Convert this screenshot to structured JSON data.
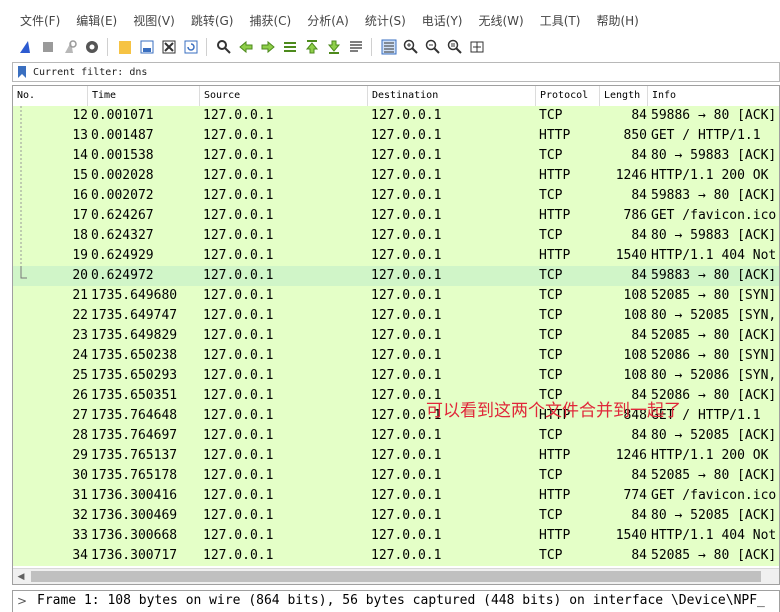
{
  "menu": [
    "文件(F)",
    "编辑(E)",
    "视图(V)",
    "跳转(G)",
    "捕获(C)",
    "分析(A)",
    "统计(S)",
    "电话(Y)",
    "无线(W)",
    "工具(T)",
    "帮助(H)"
  ],
  "toolbar_icons": [
    "shark-fin-start-icon",
    "stop-icon",
    "restart-icon",
    "capture-options-icon",
    "|",
    "open-file-icon",
    "save-file-icon",
    "close-file-icon",
    "reload-icon",
    "|",
    "find-packet-icon",
    "go-back-icon",
    "go-forward-icon",
    "go-to-packet-icon",
    "go-first-icon",
    "go-last-icon",
    "auto-scroll-icon",
    "|",
    "colorize-icon",
    "zoom-in-icon",
    "zoom-out-icon",
    "zoom-normal-icon",
    "resize-columns-icon"
  ],
  "filter": {
    "text": "Current filter: dns"
  },
  "columns": {
    "no": "No.",
    "time": "Time",
    "source": "Source",
    "destination": "Destination",
    "protocol": "Protocol",
    "length": "Length",
    "info": "Info"
  },
  "packets": [
    {
      "no": "12",
      "time": "0.001071",
      "src": "127.0.0.1",
      "dst": "127.0.0.1",
      "proto": "TCP",
      "len": "84",
      "info": "59886 → 80 [ACK]"
    },
    {
      "no": "13",
      "time": "0.001487",
      "src": "127.0.0.1",
      "dst": "127.0.0.1",
      "proto": "HTTP",
      "len": "850",
      "info": "GET / HTTP/1.1"
    },
    {
      "no": "14",
      "time": "0.001538",
      "src": "127.0.0.1",
      "dst": "127.0.0.1",
      "proto": "TCP",
      "len": "84",
      "info": "80 → 59883 [ACK]"
    },
    {
      "no": "15",
      "time": "0.002028",
      "src": "127.0.0.1",
      "dst": "127.0.0.1",
      "proto": "HTTP",
      "len": "1246",
      "info": "HTTP/1.1 200 OK"
    },
    {
      "no": "16",
      "time": "0.002072",
      "src": "127.0.0.1",
      "dst": "127.0.0.1",
      "proto": "TCP",
      "len": "84",
      "info": "59883 → 80 [ACK]"
    },
    {
      "no": "17",
      "time": "0.624267",
      "src": "127.0.0.1",
      "dst": "127.0.0.1",
      "proto": "HTTP",
      "len": "786",
      "info": "GET /favicon.ico"
    },
    {
      "no": "18",
      "time": "0.624327",
      "src": "127.0.0.1",
      "dst": "127.0.0.1",
      "proto": "TCP",
      "len": "84",
      "info": "80 → 59883 [ACK]"
    },
    {
      "no": "19",
      "time": "0.624929",
      "src": "127.0.0.1",
      "dst": "127.0.0.1",
      "proto": "HTTP",
      "len": "1540",
      "info": "HTTP/1.1 404 Not"
    },
    {
      "no": "20",
      "time": "0.624972",
      "src": "127.0.0.1",
      "dst": "127.0.0.1",
      "proto": "TCP",
      "len": "84",
      "info": "59883 → 80 [ACK]",
      "selected": true
    },
    {
      "no": "21",
      "time": "1735.649680",
      "src": "127.0.0.1",
      "dst": "127.0.0.1",
      "proto": "TCP",
      "len": "108",
      "info": "52085 → 80 [SYN]"
    },
    {
      "no": "22",
      "time": "1735.649747",
      "src": "127.0.0.1",
      "dst": "127.0.0.1",
      "proto": "TCP",
      "len": "108",
      "info": "80 → 52085 [SYN,"
    },
    {
      "no": "23",
      "time": "1735.649829",
      "src": "127.0.0.1",
      "dst": "127.0.0.1",
      "proto": "TCP",
      "len": "84",
      "info": "52085 → 80 [ACK]"
    },
    {
      "no": "24",
      "time": "1735.650238",
      "src": "127.0.0.1",
      "dst": "127.0.0.1",
      "proto": "TCP",
      "len": "108",
      "info": "52086 → 80 [SYN]"
    },
    {
      "no": "25",
      "time": "1735.650293",
      "src": "127.0.0.1",
      "dst": "127.0.0.1",
      "proto": "TCP",
      "len": "108",
      "info": "80 → 52086 [SYN,"
    },
    {
      "no": "26",
      "time": "1735.650351",
      "src": "127.0.0.1",
      "dst": "127.0.0.1",
      "proto": "TCP",
      "len": "84",
      "info": "52086 → 80 [ACK]"
    },
    {
      "no": "27",
      "time": "1735.764648",
      "src": "127.0.0.1",
      "dst": "127.0.0.1",
      "proto": "HTTP",
      "len": "848",
      "info": "GET / HTTP/1.1"
    },
    {
      "no": "28",
      "time": "1735.764697",
      "src": "127.0.0.1",
      "dst": "127.0.0.1",
      "proto": "TCP",
      "len": "84",
      "info": "80 → 52085 [ACK]"
    },
    {
      "no": "29",
      "time": "1735.765137",
      "src": "127.0.0.1",
      "dst": "127.0.0.1",
      "proto": "HTTP",
      "len": "1246",
      "info": "HTTP/1.1 200 OK"
    },
    {
      "no": "30",
      "time": "1735.765178",
      "src": "127.0.0.1",
      "dst": "127.0.0.1",
      "proto": "TCP",
      "len": "84",
      "info": "52085 → 80 [ACK]"
    },
    {
      "no": "31",
      "time": "1736.300416",
      "src": "127.0.0.1",
      "dst": "127.0.0.1",
      "proto": "HTTP",
      "len": "774",
      "info": "GET /favicon.ico"
    },
    {
      "no": "32",
      "time": "1736.300469",
      "src": "127.0.0.1",
      "dst": "127.0.0.1",
      "proto": "TCP",
      "len": "84",
      "info": "80 → 52085 [ACK]"
    },
    {
      "no": "33",
      "time": "1736.300668",
      "src": "127.0.0.1",
      "dst": "127.0.0.1",
      "proto": "HTTP",
      "len": "1540",
      "info": "HTTP/1.1 404 Not"
    },
    {
      "no": "34",
      "time": "1736.300717",
      "src": "127.0.0.1",
      "dst": "127.0.0.1",
      "proto": "TCP",
      "len": "84",
      "info": "52085 → 80 [ACK]"
    }
  ],
  "detail": {
    "arrow": ">",
    "text": "Frame 1: 108 bytes on wire (864 bits), 56 bytes captured (448 bits) on interface \\Device\\NPF_"
  },
  "annotation": "可以看到这两个文件合并到一起了",
  "colors": {
    "row_bg": "#e4ffc7",
    "selected_bg": "#d0f5c8",
    "annotation": "#e0283a"
  }
}
